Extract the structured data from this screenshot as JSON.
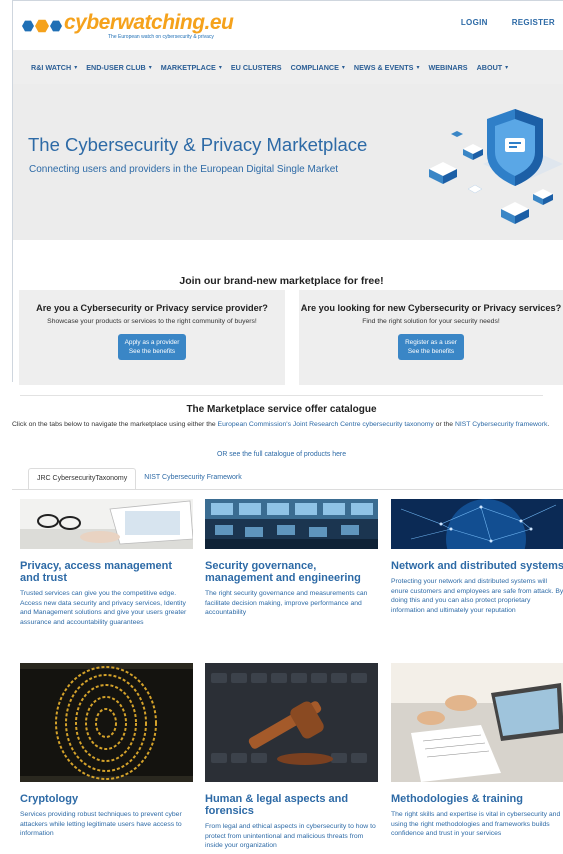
{
  "header": {
    "logo_word": "cyberwatching.eu",
    "logo_tagline": "The European watch on cybersecurity & privacy",
    "links": [
      "LOGIN",
      "REGISTER"
    ]
  },
  "nav": {
    "items": [
      {
        "label": "R&I WATCH",
        "dropdown": true
      },
      {
        "label": "END-USER CLUB",
        "dropdown": true
      },
      {
        "label": "MARKETPLACE",
        "dropdown": true
      },
      {
        "label": "EU CLUSTERS",
        "dropdown": false
      },
      {
        "label": "COMPLIANCE",
        "dropdown": true
      },
      {
        "label": "NEWS & EVENTS",
        "dropdown": true
      },
      {
        "label": "WEBINARS",
        "dropdown": false
      },
      {
        "label": "ABOUT",
        "dropdown": true
      }
    ]
  },
  "hero": {
    "title": "The Cybersecurity & Privacy Marketplace",
    "subtitle": "Connecting users and providers in the European Digital Single Market"
  },
  "join": {
    "title": "Join our brand-new marketplace for free!",
    "provider": {
      "heading": "Are you a Cybersecurity or Privacy service provider?",
      "text": "Showcase your products or services to the right community of buyers!",
      "button_line1": "Apply as a provider",
      "button_line2": "See the benefits"
    },
    "user": {
      "heading": "Are you looking for new Cybersecurity or Privacy services?",
      "text": "Find the right solution for your security needs!",
      "button_line1": "Register as a user",
      "button_line2": "See the benefits"
    }
  },
  "catalogue": {
    "title": "The Marketplace service offer catalogue",
    "intro_before": "Click on the tabs below to navigate the marketplace using either the ",
    "intro_link1": "European Commission's Joint Research Centre cybersecurity taxonomy",
    "intro_mid": " or the ",
    "intro_link2": "NIST Cybersecurity framework",
    "intro_after": ".",
    "full_link": "OR see the full catalogue of products here",
    "tabs": [
      "JRC CybersecurityTaxonomy",
      "NIST Cybersecurity Framework"
    ],
    "cards": [
      {
        "title": "Privacy, access management and trust",
        "text": "Trusted services can give you the competitive edge. Access new data security and privacy services, Identity and Management solutions and give your users greater assurance and accountability guarantees"
      },
      {
        "title": "Security governance, management and engineering",
        "text": "The right security governance and measurements can facilitate decision making, improve performance and accountability"
      },
      {
        "title": "Network and distributed systems",
        "text": "Protecting your network and distributed systems will enure customers and employees are safe from attack. By doing this and you can also protect proprietary information and ultimately your reputation"
      },
      {
        "title": "Cryptology",
        "text": "Services providing robust techniques to prevent cyber attackers while letting legitimate users have access to information"
      },
      {
        "title": "Human & legal aspects and forensics",
        "text": "From legal and ethical aspects in cybersecurity to how to protect from unintentional and malicious threats from inside your organization"
      },
      {
        "title": "Methodologies & training",
        "text": "The right skills and expertise is vital in cybersecurity and using the right methodologies and frameworks builds confidence and trust in your services"
      }
    ]
  },
  "colors": {
    "brand_blue": "#2d6aa6",
    "brand_orange": "#f5a21c",
    "button_blue": "#3a86c6"
  }
}
